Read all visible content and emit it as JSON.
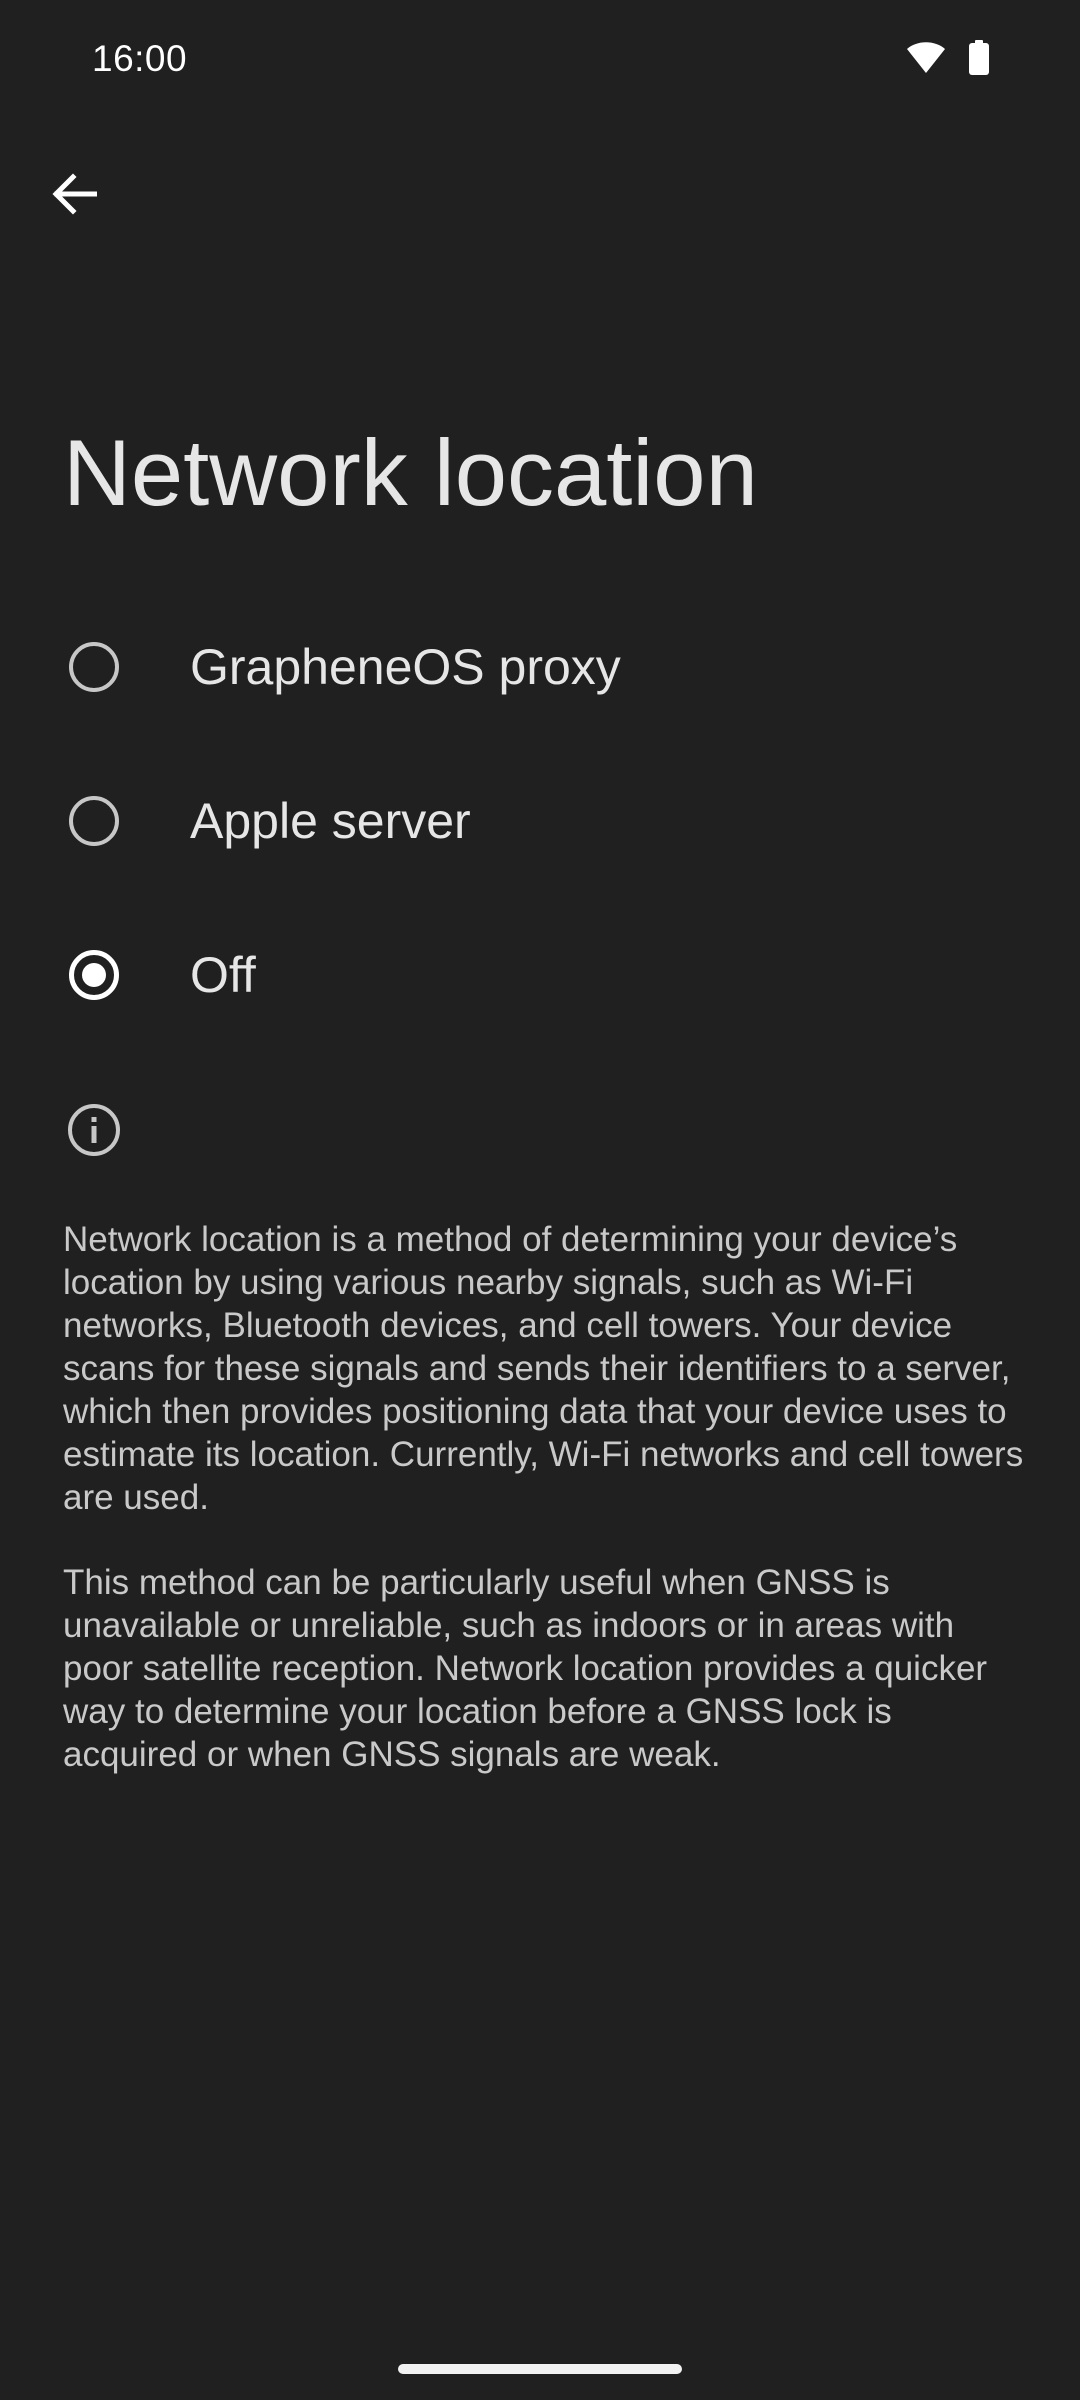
{
  "status_bar": {
    "time": "16:00",
    "icons": [
      "wifi-icon",
      "battery-icon"
    ]
  },
  "toolbar": {
    "back_icon": "arrow-back-icon"
  },
  "page": {
    "title": "Network location"
  },
  "options": [
    {
      "label": "GrapheneOS proxy",
      "selected": false
    },
    {
      "label": "Apple server",
      "selected": false
    },
    {
      "label": "Off",
      "selected": true
    }
  ],
  "info": {
    "icon": "info-icon",
    "paragraphs": [
      "Network location is a method of determining your device’s location by using various nearby signals, such as Wi-Fi networks, Bluetooth devices, and cell towers. Your device scans for these signals and sends their identifiers to a server, which then provides positioning data that your device uses to estimate its location. Currently, Wi-Fi networks and cell towers are used.",
      "This method can be particularly useful when GNSS is unavailable or unreliable, such as indoors or in areas with poor satellite reception. Network location provides a quicker way to determine your location before a GNSS lock is acquired or when GNSS signals are weak."
    ]
  },
  "colors": {
    "background": "#202020",
    "text_primary": "#e6e6e6",
    "text_secondary": "#c9c9c9",
    "radio_selected": "#ffffff"
  }
}
